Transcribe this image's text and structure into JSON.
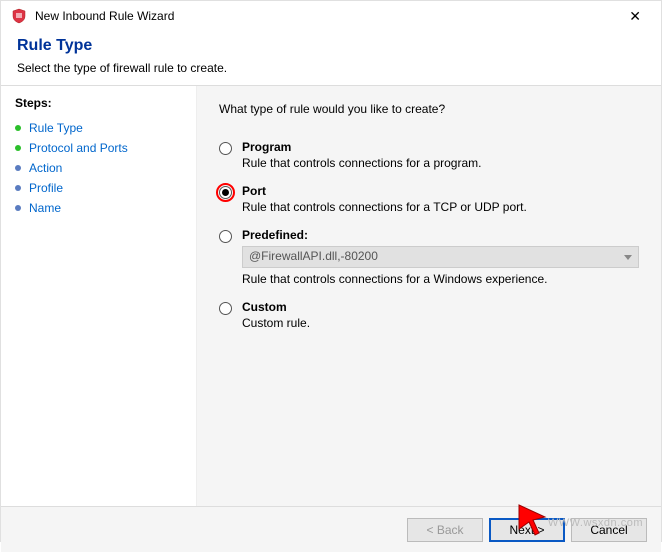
{
  "window": {
    "title": "New Inbound Rule Wizard",
    "close_glyph": "✕"
  },
  "header": {
    "title": "Rule Type",
    "subtitle": "Select the type of firewall rule to create."
  },
  "steps": {
    "heading": "Steps:",
    "items": [
      {
        "label": "Rule Type",
        "status": "done"
      },
      {
        "label": "Protocol and Ports",
        "status": "done"
      },
      {
        "label": "Action",
        "status": "pending"
      },
      {
        "label": "Profile",
        "status": "pending"
      },
      {
        "label": "Name",
        "status": "pending"
      }
    ]
  },
  "content": {
    "prompt": "What type of rule would you like to create?",
    "options": {
      "program": {
        "label": "Program",
        "desc": "Rule that controls connections for a program."
      },
      "port": {
        "label": "Port",
        "desc": "Rule that controls connections for a TCP or UDP port."
      },
      "predefined": {
        "label": "Predefined:",
        "select_value": "@FirewallAPI.dll,-80200",
        "desc": "Rule that controls connections for a Windows experience."
      },
      "custom": {
        "label": "Custom",
        "desc": "Custom rule."
      }
    },
    "selected": "port"
  },
  "footer": {
    "back": "< Back",
    "next": "Next >",
    "cancel": "Cancel"
  },
  "watermark": "WWW.wsxdn.com"
}
